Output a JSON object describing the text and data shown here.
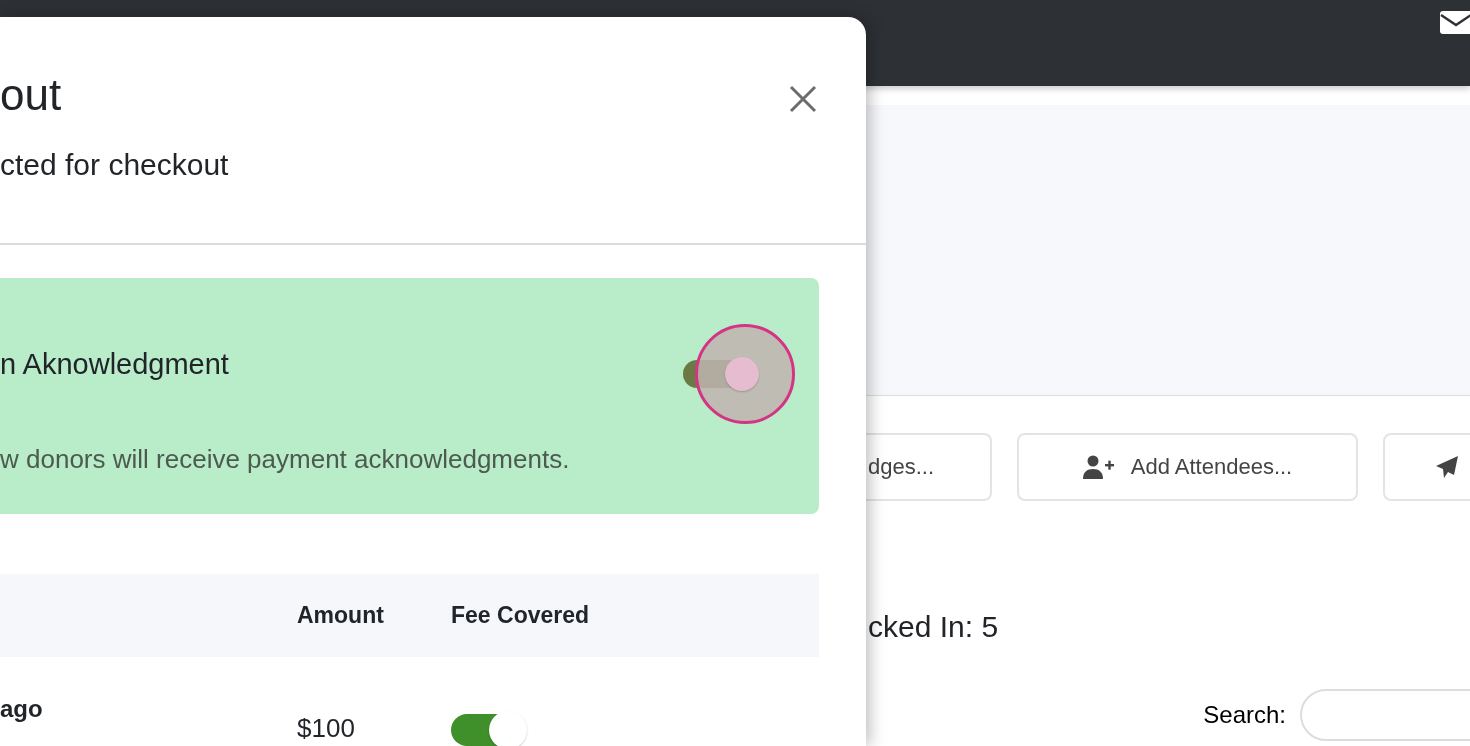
{
  "page": {
    "buttons": [
      {
        "kind": "text",
        "label": "dges..."
      },
      {
        "kind": "labeled",
        "label": "Add Attendees..."
      },
      {
        "kind": "icon"
      }
    ],
    "checked_in": "cked In: 5",
    "search": {
      "label": "Search:"
    }
  },
  "modal": {
    "title": "out",
    "subtitle": "cted for checkout",
    "acknowledgment": {
      "title": "n Aknowledgment",
      "description": "w donors will receive payment acknowledgments.",
      "on": true,
      "focused": true
    },
    "table": {
      "columns": [
        "Amount",
        "Fee Covered"
      ],
      "rows": [
        {
          "name": "ago",
          "amount": "$100",
          "fee_covered": true
        }
      ]
    }
  }
}
